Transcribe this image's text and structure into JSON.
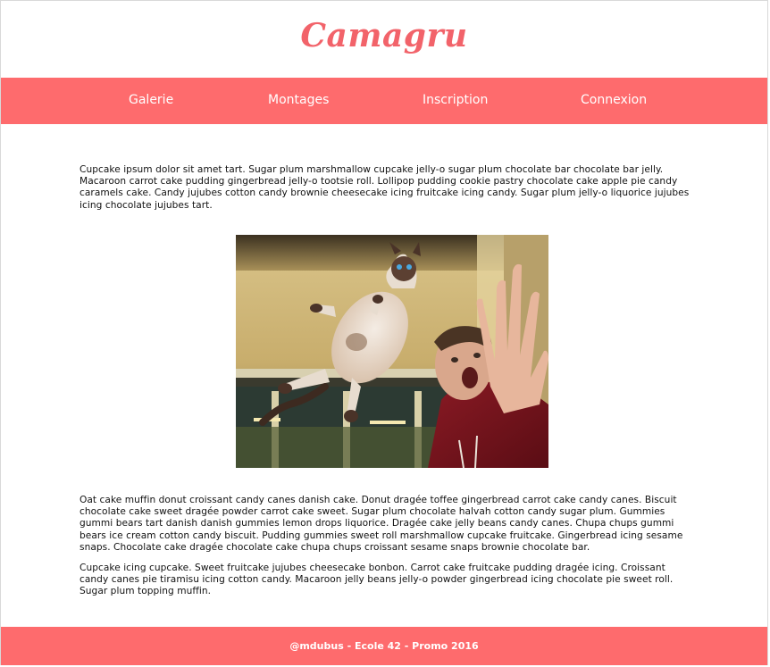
{
  "header": {
    "logo": "Camagru"
  },
  "nav": {
    "items": [
      {
        "label": "Galerie"
      },
      {
        "label": "Montages"
      },
      {
        "label": "Inscription"
      },
      {
        "label": "Connexion"
      }
    ]
  },
  "main": {
    "paragraph1": "Cupcake ipsum dolor sit amet tart. Sugar plum marshmallow cupcake jelly-o sugar plum chocolate bar chocolate bar jelly. Macaroon carrot cake pudding gingerbread jelly-o tootsie roll. Lollipop pudding cookie pastry chocolate cake apple pie candy caramels cake. Candy jujubes cotton candy brownie cheesecake icing fruitcake icing candy. Sugar plum jelly-o liquorice jujubes icing chocolate jujubes tart.",
    "paragraph2": "Oat cake muffin donut croissant candy canes danish cake. Donut dragée toffee gingerbread carrot cake candy canes. Biscuit chocolate cake sweet dragée powder carrot cake sweet. Sugar plum chocolate halvah cotton candy sugar plum. Gummies gummi bears tart danish danish gummies lemon drops liquorice. Dragée cake jelly beans candy canes. Chupa chups gummi bears ice cream cotton candy biscuit. Pudding gummies sweet roll marshmallow cupcake fruitcake. Gingerbread icing sesame snaps. Chocolate cake dragée chocolate cake chupa chups croissant sesame snaps brownie chocolate bar.",
    "paragraph3": "Cupcake icing cupcake. Sweet fruitcake jujubes cheesecake bonbon. Carrot cake fruitcake pudding dragée icing. Croissant candy canes pie tiramisu icing cotton candy. Macaroon jelly beans jelly-o powder gingerbread icing chocolate pie sweet roll. Sugar plum topping muffin."
  },
  "footer": {
    "text": "@mdubus - Ecole 42 - Promo 2016"
  },
  "colors": {
    "accent": "#fe6b6d",
    "logo": "#f2636a"
  }
}
